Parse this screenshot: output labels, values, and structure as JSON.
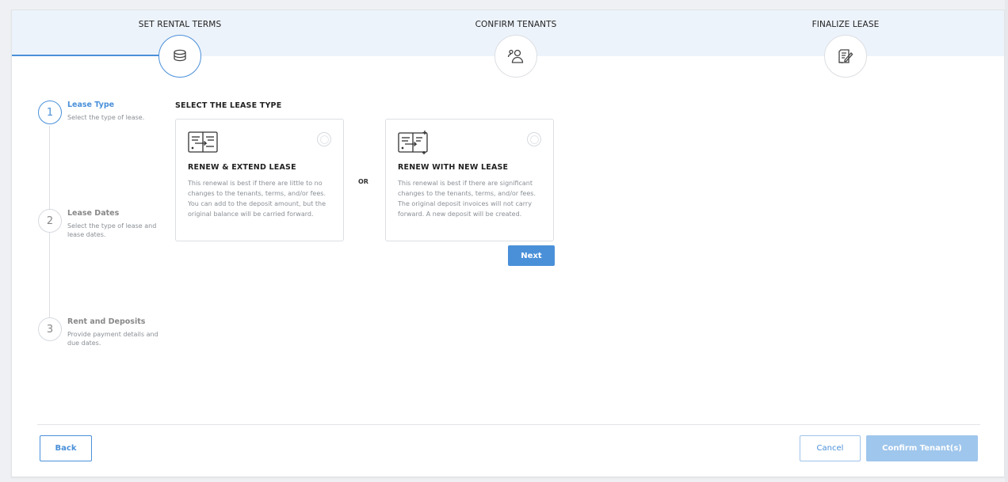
{
  "wizard": {
    "steps": [
      {
        "label": "SET RENTAL TERMS",
        "icon": "coins-icon",
        "active": true
      },
      {
        "label": "CONFIRM TENANTS",
        "icon": "user-group-icon",
        "active": false
      },
      {
        "label": "FINALIZE LEASE",
        "icon": "signed-document-icon",
        "active": false
      }
    ]
  },
  "substeps": [
    {
      "number": "1",
      "title": "Lease Type",
      "description": "Select the type of lease.",
      "active": true
    },
    {
      "number": "2",
      "title": "Lease Dates",
      "description": "Select the type of lease and lease dates.",
      "active": false
    },
    {
      "number": "3",
      "title": "Rent and Deposits",
      "description": "Provide payment details and due dates.",
      "active": false
    }
  ],
  "lease_type": {
    "section_title": "SELECT THE LEASE TYPE",
    "or_label": "OR",
    "options": [
      {
        "title": "RENEW & EXTEND LEASE",
        "description": "This renewal is best if there are little to no changes to the tenants, terms, and/or fees. You can add to the deposit amount, but the original balance will be carried forward.",
        "icon": "lease-extend-icon",
        "selected": false
      },
      {
        "title": "RENEW WITH NEW LEASE",
        "description": "This renewal is best if there are significant changes to the tenants, terms, and/or fees. The original deposit invoices will not carry forward. A new deposit will be created.",
        "icon": "lease-new-icon",
        "selected": false
      }
    ],
    "next_label": "Next"
  },
  "footer": {
    "back_label": "Back",
    "cancel_label": "Cancel",
    "confirm_label": "Confirm Tenant(s)"
  },
  "colors": {
    "accent": "#4a90d9",
    "accent_disabled": "#9fc6ec",
    "band": "#edf3fb"
  }
}
